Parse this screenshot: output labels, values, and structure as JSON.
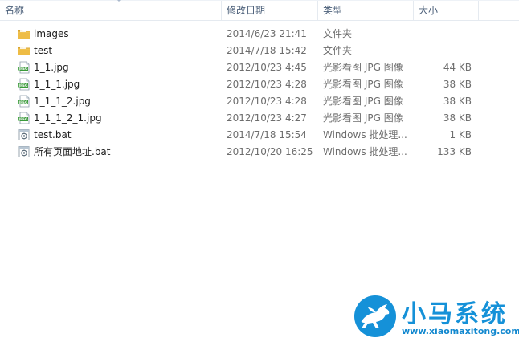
{
  "columns": {
    "name": "名称",
    "date": "修改日期",
    "type": "类型",
    "size": "大小"
  },
  "files": [
    {
      "icon": "folder-icon",
      "name": "images",
      "date": "2014/6/23 21:41",
      "type": "文件夹",
      "size": ""
    },
    {
      "icon": "folder-icon",
      "name": "test",
      "date": "2014/7/18 15:42",
      "type": "文件夹",
      "size": ""
    },
    {
      "icon": "jpeg-file-icon",
      "name": "1_1.jpg",
      "date": "2012/10/23 4:45",
      "type": "光影看图 JPG 图像",
      "size": "44 KB"
    },
    {
      "icon": "jpeg-file-icon",
      "name": "1_1_1.jpg",
      "date": "2012/10/23 4:28",
      "type": "光影看图 JPG 图像",
      "size": "38 KB"
    },
    {
      "icon": "jpeg-file-icon",
      "name": "1_1_1_2.jpg",
      "date": "2012/10/23 4:28",
      "type": "光影看图 JPG 图像",
      "size": "38 KB"
    },
    {
      "icon": "jpeg-file-icon",
      "name": "1_1_1_2_1.jpg",
      "date": "2012/10/23 4:27",
      "type": "光影看图 JPG 图像",
      "size": "38 KB"
    },
    {
      "icon": "batch-file-icon",
      "name": "test.bat",
      "date": "2014/7/18 15:54",
      "type": "Windows 批处理...",
      "size": "1 KB"
    },
    {
      "icon": "batch-file-icon",
      "name": "所有页面地址.bat",
      "date": "2012/10/20 16:25",
      "type": "Windows 批处理...",
      "size": "133 KB"
    }
  ],
  "watermark": {
    "title": "小马系统",
    "url": "www.xiaomaxitong.com"
  },
  "colors": {
    "header_text": "#4c607a",
    "secondary_text": "#6d6d6d",
    "folder": "#e8b84a",
    "jpeg_badge": "#3a9a3a",
    "watermark": "#1591d8"
  }
}
